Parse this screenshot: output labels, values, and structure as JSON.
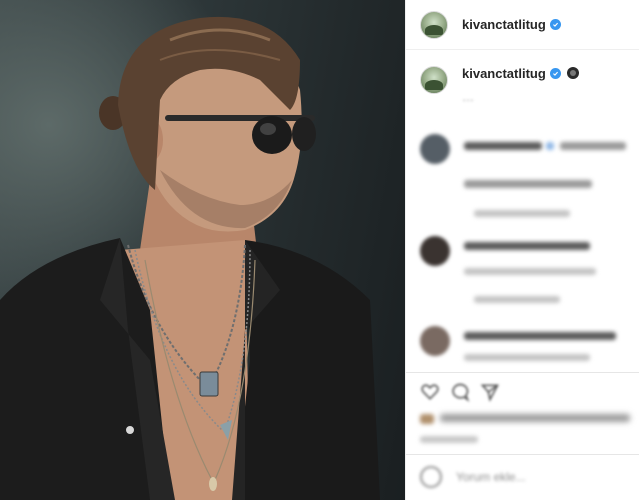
{
  "post": {
    "author": {
      "username": "kivanctatlitug"
    },
    "caption_user": {
      "username": "kivanctatlitug"
    },
    "caption_text": "…",
    "comment_placeholder": "Yorum ekle..."
  },
  "colors": {
    "verified_blue": "#3897f0",
    "username_text": "#262626",
    "photo_background": "#2f393b",
    "shirt": "#1b1b1b",
    "skin": "#c79a7e"
  },
  "icons": [
    "verified-icon",
    "heart-icon",
    "comment-icon",
    "share-icon",
    "emoji-icon"
  ]
}
